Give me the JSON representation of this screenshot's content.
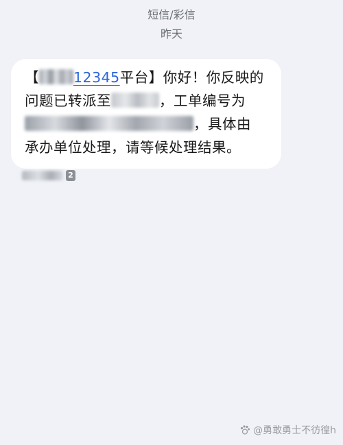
{
  "header": {
    "type": "短信/彩信",
    "date": "昨天"
  },
  "message": {
    "open_bracket": "【",
    "platform_number": "12345",
    "platform_suffix": "平台】你好！你反映的",
    "line2_prefix": "问题已转派至",
    "line2_suffix": "，工单编号为",
    "line3_suffix": "，具体由",
    "line4": "承办单位处理，请等候处理结果。"
  },
  "meta": {
    "sim_slot": "2"
  },
  "watermark": {
    "text": "@勇敢勇士不彷徨h"
  },
  "colors": {
    "background": "#f0f2f7",
    "bubble": "#ffffff",
    "link": "#2b66d9"
  }
}
